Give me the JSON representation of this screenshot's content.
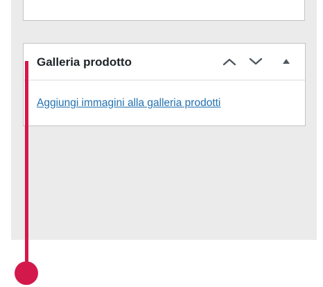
{
  "metabox": {
    "title": "Galleria prodotto",
    "add_images_link": "Aggiungi immagini alla galleria prodotti",
    "icons": {
      "move_up": "chevron-up-icon",
      "move_down": "chevron-down-icon",
      "toggle": "triangle-up-icon"
    }
  },
  "colors": {
    "page_background": "#ebebeb",
    "link": "#2271b1",
    "title": "#1d2327",
    "callout": "#d3194b",
    "header_icons": "#50575e"
  }
}
